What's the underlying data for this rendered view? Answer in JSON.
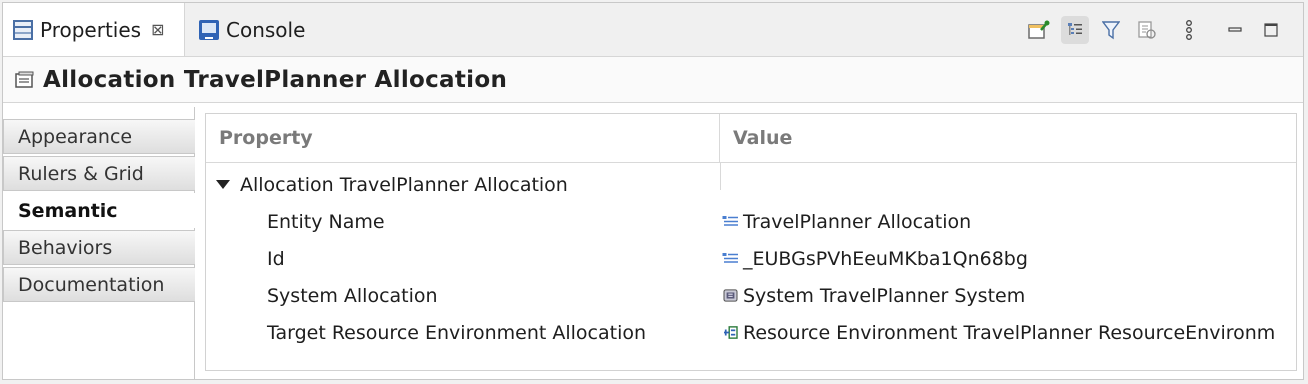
{
  "tabs": {
    "properties_label": "Properties",
    "console_label": "Console",
    "close_glyph": "⊠"
  },
  "toolbar": {
    "icons": [
      "pin-editor-icon",
      "show-categories-icon",
      "filter-icon",
      "restore-defaults-icon",
      "view-menu-icon",
      "minimize-icon",
      "maximize-icon"
    ]
  },
  "header": {
    "title": "Allocation TravelPlanner Allocation"
  },
  "sidebar": {
    "items": [
      {
        "label": "Appearance"
      },
      {
        "label": "Rulers & Grid"
      },
      {
        "label": "Semantic"
      },
      {
        "label": "Behaviors"
      },
      {
        "label": "Documentation"
      }
    ],
    "selected": "Semantic"
  },
  "table": {
    "col_property": "Property",
    "col_value": "Value",
    "group": "Allocation TravelPlanner Allocation",
    "rows": [
      {
        "property": "Entity Name",
        "value": "TravelPlanner Allocation",
        "icon": "text-property-icon"
      },
      {
        "property": "Id",
        "value": "_EUBGsPVhEeuMKba1Qn68bg",
        "icon": "text-property-icon"
      },
      {
        "property": "System Allocation",
        "value": "System TravelPlanner System",
        "icon": "system-icon"
      },
      {
        "property": "Target Resource Environment Allocation",
        "value": "Resource Environment TravelPlanner ResourceEnvironm",
        "icon": "resource-environment-icon"
      }
    ]
  },
  "colors": {
    "accent": "#2f63b5",
    "tab_bg": "#f0f0f0",
    "border": "#c8c8c8"
  }
}
